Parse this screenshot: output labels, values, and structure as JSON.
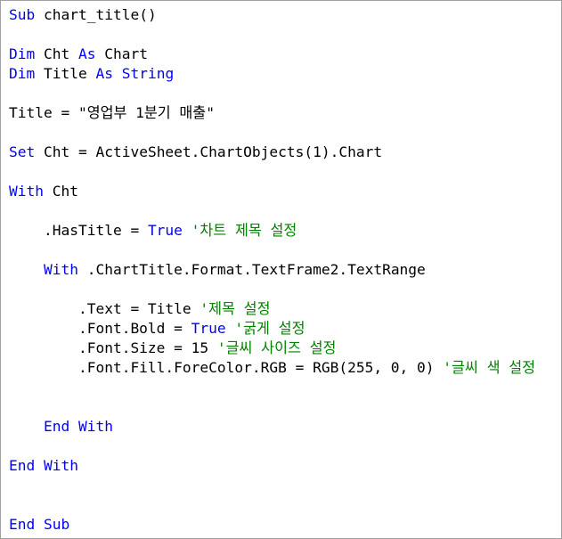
{
  "colors": {
    "keyword": "#0000ff",
    "comment": "#008000",
    "text": "#000000",
    "background": "#ffffff"
  },
  "lines": [
    [
      {
        "t": "kw",
        "v": "Sub"
      },
      {
        "t": "tx",
        "v": " chart_title()"
      }
    ],
    [],
    [
      {
        "t": "kw",
        "v": "Dim"
      },
      {
        "t": "tx",
        "v": " Cht "
      },
      {
        "t": "kw",
        "v": "As"
      },
      {
        "t": "tx",
        "v": " Chart"
      }
    ],
    [
      {
        "t": "kw",
        "v": "Dim"
      },
      {
        "t": "tx",
        "v": " Title "
      },
      {
        "t": "kw",
        "v": "As"
      },
      {
        "t": "tx",
        "v": " "
      },
      {
        "t": "kw",
        "v": "String"
      }
    ],
    [],
    [
      {
        "t": "tx",
        "v": "Title = \"영업부 1분기 매출\""
      }
    ],
    [],
    [
      {
        "t": "kw",
        "v": "Set"
      },
      {
        "t": "tx",
        "v": " Cht = ActiveSheet.ChartObjects(1).Chart"
      }
    ],
    [],
    [
      {
        "t": "kw",
        "v": "With"
      },
      {
        "t": "tx",
        "v": " Cht"
      }
    ],
    [],
    [
      {
        "t": "tx",
        "v": "    .HasTitle = "
      },
      {
        "t": "kw",
        "v": "True"
      },
      {
        "t": "tx",
        "v": " "
      },
      {
        "t": "cm",
        "v": "'차트 제목 설정"
      }
    ],
    [],
    [
      {
        "t": "tx",
        "v": "    "
      },
      {
        "t": "kw",
        "v": "With"
      },
      {
        "t": "tx",
        "v": " .ChartTitle.Format.TextFrame2.TextRange"
      }
    ],
    [],
    [
      {
        "t": "tx",
        "v": "        .Text = Title "
      },
      {
        "t": "cm",
        "v": "'제목 설정"
      }
    ],
    [
      {
        "t": "tx",
        "v": "        .Font.Bold = "
      },
      {
        "t": "kw",
        "v": "True"
      },
      {
        "t": "tx",
        "v": " "
      },
      {
        "t": "cm",
        "v": "'굵게 설정"
      }
    ],
    [
      {
        "t": "tx",
        "v": "        .Font.Size = 15 "
      },
      {
        "t": "cm",
        "v": "'글씨 사이즈 설정"
      }
    ],
    [
      {
        "t": "tx",
        "v": "        .Font.Fill.ForeColor.RGB = RGB(255, 0, 0) "
      },
      {
        "t": "cm",
        "v": "'글씨 색 설정"
      }
    ],
    [],
    [],
    [
      {
        "t": "tx",
        "v": "    "
      },
      {
        "t": "kw",
        "v": "End"
      },
      {
        "t": "tx",
        "v": " "
      },
      {
        "t": "kw",
        "v": "With"
      }
    ],
    [],
    [
      {
        "t": "kw",
        "v": "End"
      },
      {
        "t": "tx",
        "v": " "
      },
      {
        "t": "kw",
        "v": "With"
      }
    ],
    [],
    [],
    [
      {
        "t": "kw",
        "v": "End"
      },
      {
        "t": "tx",
        "v": " "
      },
      {
        "t": "kw",
        "v": "Sub"
      }
    ]
  ]
}
